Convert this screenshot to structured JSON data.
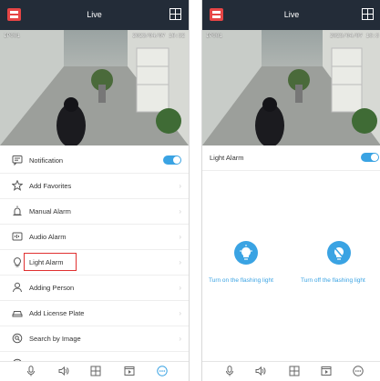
{
  "left_screen": {
    "title": "Live",
    "camera_label": "IPC01",
    "timestamp": "2023/04/07 16:32",
    "menu": [
      {
        "label": "Notification",
        "control": "toggle",
        "toggle_on": true
      },
      {
        "label": "Add Favorites"
      },
      {
        "label": "Manual Alarm"
      },
      {
        "label": "Audio Alarm"
      },
      {
        "label": "Light Alarm",
        "highlighted": true
      },
      {
        "label": "Adding Person"
      },
      {
        "label": "Add License Plate"
      },
      {
        "label": "Search by Image"
      },
      {
        "label": "Search by Name"
      }
    ],
    "chevron": "›"
  },
  "right_screen": {
    "title": "Live",
    "camera_label": "IPC01",
    "timestamp": "2023/04/07 16:3",
    "light_alarm": {
      "label": "Light Alarm",
      "toggle_on": true
    },
    "flash_on_label": "Turn on the flashing light",
    "flash_off_label": "Turn off the flashing light"
  },
  "colors": {
    "accent": "#3aa3e3",
    "topbar": "#232c38",
    "highlight_border": "#e03030"
  }
}
